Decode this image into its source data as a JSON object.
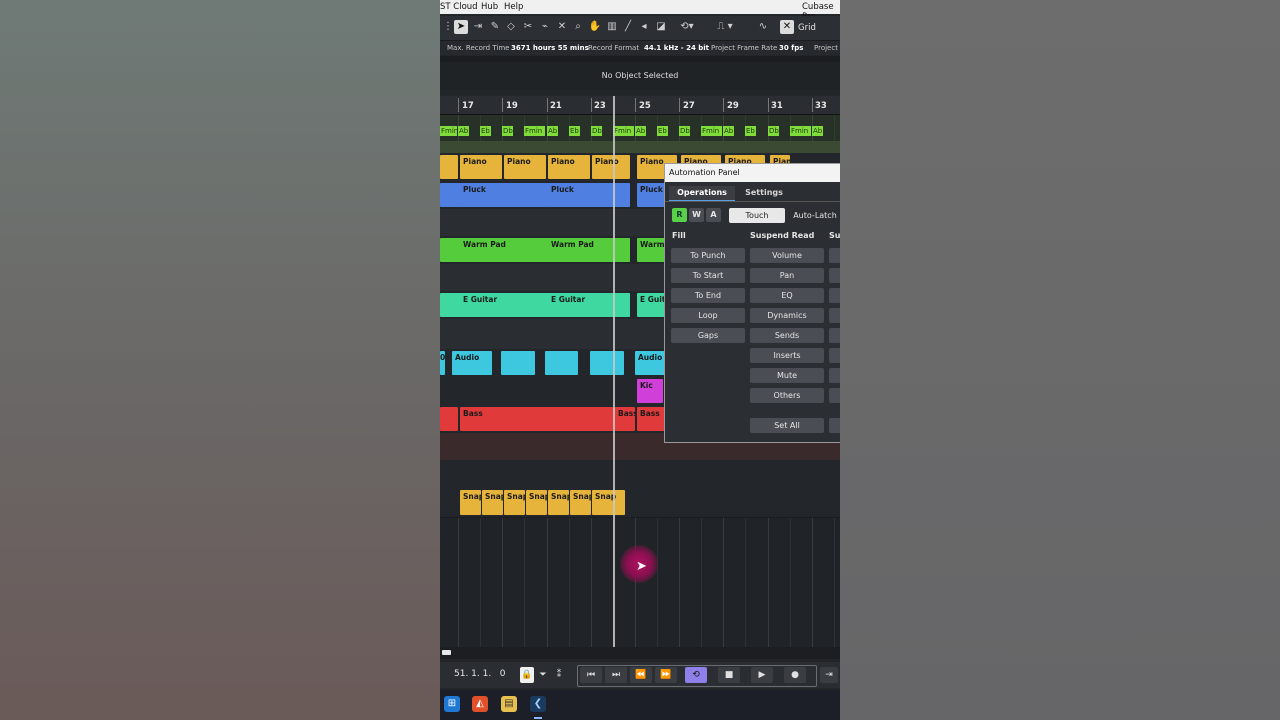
{
  "menu": {
    "item1": "ST Cloud",
    "item2": "Hub",
    "item3": "Help",
    "app_title": "Cubase Pro"
  },
  "toolbar": {
    "grid_label": "Grid"
  },
  "info": {
    "max_record_time_label": "Max. Record Time",
    "max_record_time": "3671 hours 55 mins",
    "record_format_label": "Record Format",
    "record_format": "44.1 kHz - 24 bit",
    "frame_rate_label": "Project Frame Rate",
    "frame_rate": "30 fps",
    "project_label": "Project P"
  },
  "status": {
    "no_object": "No Object Selected"
  },
  "ruler": [
    "17",
    "19",
    "21",
    "23",
    "25",
    "27",
    "29",
    "31",
    "33"
  ],
  "chords": [
    "Fmin",
    "Ab",
    "Eb",
    "Db",
    "Fmin",
    "Ab",
    "Eb",
    "Db",
    "Fmin",
    "Ab",
    "Eb",
    "Db",
    "Fmin",
    "Ab",
    "Eb",
    "Db",
    "Fmin",
    "Ab"
  ],
  "clips": {
    "piano": [
      "Piano",
      "Piano",
      "Piano",
      "Piano",
      "Piano",
      "Piano",
      "Piano",
      "Piano"
    ],
    "pluck": [
      "Pluck",
      "Pluck",
      "Pluck"
    ],
    "warm_pad": [
      "Warm Pad",
      "Warm Pad",
      "Warm"
    ],
    "guitar": [
      "E Guitar",
      "E Guitar",
      "E Guita"
    ],
    "audio": [
      "0",
      "Audio",
      "Audio"
    ],
    "kick": "Kic",
    "bass": [
      "Bass",
      "Bass",
      "Bass"
    ],
    "snap": [
      "Snap",
      "Snap",
      "Snap",
      "Snap",
      "Snap",
      "Snap",
      "Snap"
    ]
  },
  "automation_panel": {
    "title": "Automation Panel",
    "tab_operations": "Operations",
    "tab_settings": "Settings",
    "r": "R",
    "w": "W",
    "a": "A",
    "mode_touch": "Touch",
    "mode_autolatch": "Auto-Latch",
    "fill_label": "Fill",
    "suspend_read_label": "Suspend Read",
    "suspend_write_label": "Su",
    "fill_buttons": [
      "To Punch",
      "To Start",
      "To End",
      "Loop",
      "Gaps"
    ],
    "suspend_buttons": [
      "Volume",
      "Pan",
      "EQ",
      "Dynamics",
      "Sends",
      "Inserts",
      "Mute",
      "Others"
    ],
    "set_all": "Set All"
  },
  "transport": {
    "position": "51. 1. 1.   0"
  }
}
